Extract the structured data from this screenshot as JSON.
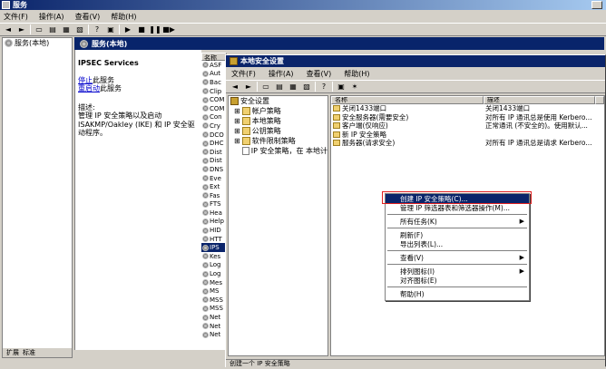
{
  "services_window": {
    "title": "服务",
    "menu": [
      "文件(F)",
      "操作(A)",
      "查看(V)",
      "帮助(H)"
    ],
    "tree_root": "服务(本地)",
    "tabs": [
      "扩展",
      "标准"
    ],
    "header_title": "服务(本地)",
    "selected_service": "IPSEC Services",
    "stop_link": "停止",
    "stop_suffix": "此服务",
    "restart_link": "重启动",
    "restart_suffix": "此服务",
    "desc_label": "描述:",
    "desc_text": "管理 IP 安全策略以及启动 ISAKMP/Oakley (IKE) 和 IP 安全驱动程序。",
    "list_header": "名称",
    "list_items": [
      "ASF",
      "Aut",
      "Bac",
      "Clip",
      "COM",
      "COM",
      "Con",
      "Cry",
      "DCO",
      "DHC",
      "Dist",
      "Dist",
      "DNS",
      "Eve",
      "Ext",
      "Fas",
      "FTS",
      "Hea",
      "Help",
      "HID",
      "HTT",
      "IPS",
      "Kes",
      "Log",
      "Log",
      "Mes",
      "MS",
      "MSS",
      "MSS",
      "Net",
      "Net",
      "Net"
    ],
    "selected_index": 21
  },
  "lsp_window": {
    "title": "本地安全设置",
    "menu": [
      "文件(F)",
      "操作(A)",
      "查看(V)",
      "帮助(H)"
    ],
    "tree": [
      {
        "label": "安全设置",
        "level": 0
      },
      {
        "label": "帐户策略",
        "level": 1
      },
      {
        "label": "本地策略",
        "level": 1
      },
      {
        "label": "公钥策略",
        "level": 1
      },
      {
        "label": "软件限制策略",
        "level": 1
      },
      {
        "label": "IP 安全策略，在 本地计",
        "level": 1
      }
    ],
    "columns": [
      "名称",
      "描述"
    ],
    "rows": [
      {
        "name": "关闭1433端口",
        "desc": "关闭1433端口"
      },
      {
        "name": "安全服务器(需要安全)",
        "desc": "对所有 IP 通讯总是使用 Kerbero..."
      },
      {
        "name": "客户端(仅响应)",
        "desc": "正常通讯 (不安全的)。使用默认..."
      },
      {
        "name": "新 IP 安全策略",
        "desc": ""
      },
      {
        "name": "服务器(请求安全)",
        "desc": "对所有 IP 通讯总是请求 Kerbero..."
      }
    ],
    "status": "创建一个 IP 安全策略"
  },
  "context_menu": {
    "items": [
      {
        "label": "创建 IP 安全策略(C)...",
        "highlight": true
      },
      {
        "label": "管理 IP 筛选器表和筛选器操作(M)...",
        "highlight": false
      },
      {
        "label": "所有任务(K)",
        "submenu": true
      },
      {
        "label": "刷新(F)",
        "submenu": false
      },
      {
        "label": "导出列表(L)...",
        "submenu": false
      },
      {
        "label": "查看(V)",
        "submenu": true
      },
      {
        "label": "排列图标(I)",
        "submenu": true
      },
      {
        "label": "对齐图标(E)",
        "submenu": false
      },
      {
        "label": "帮助(H)",
        "submenu": false
      }
    ]
  }
}
